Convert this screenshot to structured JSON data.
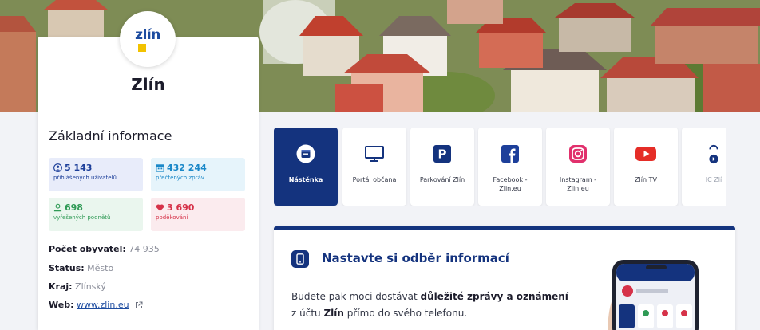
{
  "profile": {
    "logo_text": "zlín",
    "city_name": "Zlín",
    "section_title": "Základní informace",
    "stats": {
      "users": {
        "value": "5 143",
        "label": "přihlášených uživatelů",
        "icon": "users-icon"
      },
      "read": {
        "value": "432 244",
        "label": "přečtených zpráv",
        "icon": "calendar-icon"
      },
      "solved": {
        "value": "698",
        "label": "vyřešených podnětů",
        "icon": "person-check-icon"
      },
      "thanks": {
        "value": "3 690",
        "label": "poděkování",
        "icon": "heart-icon"
      }
    },
    "info": {
      "population_label": "Počet obyvatel:",
      "population_value": "74 935",
      "status_label": "Status:",
      "status_value": "Město",
      "region_label": "Kraj:",
      "region_value": "Zlínský",
      "web_label": "Web:",
      "web_value": "www.zlin.eu"
    }
  },
  "tiles": [
    {
      "label": "Nástěnka",
      "icon": "board-icon",
      "active": true
    },
    {
      "label": "Portál občana",
      "icon": "monitor-icon",
      "active": false
    },
    {
      "label": "Parkování Zlín",
      "icon": "parking-icon",
      "active": false
    },
    {
      "label": "Facebook - Zlin.eu",
      "icon": "facebook-icon",
      "active": false
    },
    {
      "label": "Instagram - Zlin.eu",
      "icon": "instagram-icon",
      "active": false
    },
    {
      "label": "Zlín TV",
      "icon": "youtube-icon",
      "active": false
    },
    {
      "label": "IC Zlí",
      "icon": "info-center-icon",
      "active": false
    }
  ],
  "subscription": {
    "title": "Nastavte si odběr informací",
    "text_1": "Budete pak moci dostávat ",
    "text_bold_1": "důležité zprávy a oznámení",
    "text_2": " z účtu ",
    "text_bold_2": "Zlín",
    "text_3": " přímo do svého telefonu."
  },
  "colors": {
    "brand_navy": "#14337e",
    "users": "#1d3f9a",
    "read": "#1a88c8",
    "solved": "#2f9a55",
    "thanks": "#d63249"
  }
}
